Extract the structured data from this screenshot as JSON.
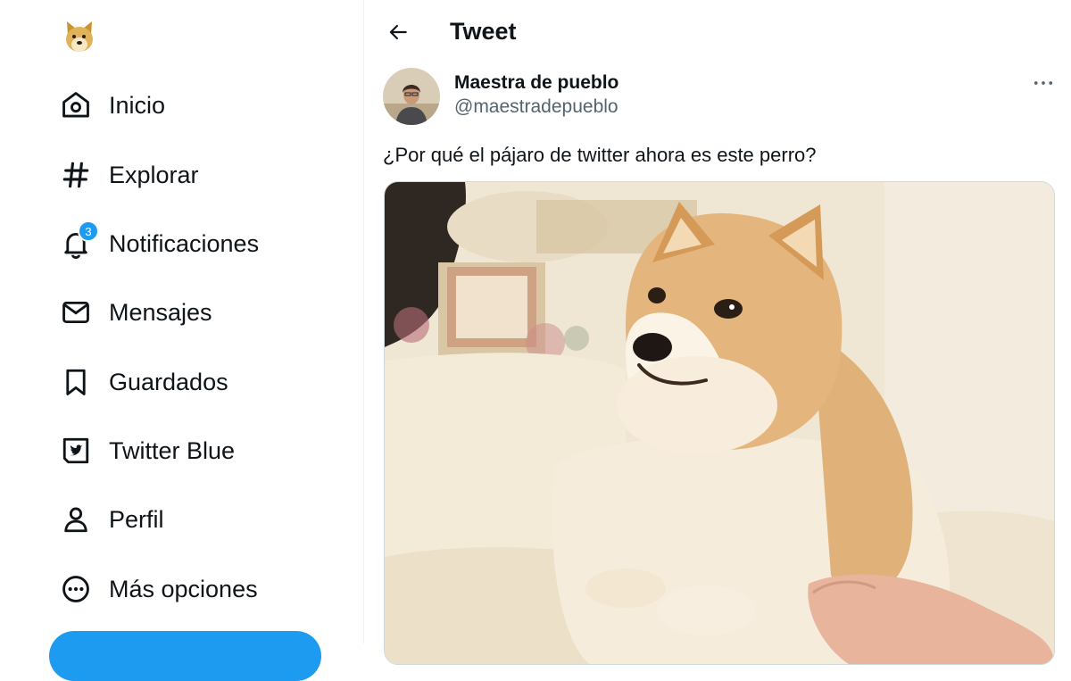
{
  "sidebar": {
    "logo": "doge-logo-icon",
    "items": [
      {
        "label": "Inicio",
        "icon": "home-icon"
      },
      {
        "label": "Explorar",
        "icon": "hashtag-icon"
      },
      {
        "label": "Notificaciones",
        "icon": "bell-icon",
        "badge": "3"
      },
      {
        "label": "Mensajes",
        "icon": "envelope-icon"
      },
      {
        "label": "Guardados",
        "icon": "bookmark-icon"
      },
      {
        "label": "Twitter Blue",
        "icon": "twitter-blue-icon"
      },
      {
        "label": "Perfil",
        "icon": "person-icon"
      },
      {
        "label": "Más opciones",
        "icon": "more-circle-icon"
      }
    ]
  },
  "header": {
    "title": "Tweet",
    "back_icon": "arrow-left-icon"
  },
  "tweet": {
    "author_name": "Maestra de pueblo",
    "author_handle": "@maestradepueblo",
    "text": "¿Por qué el pájaro de twitter ahora es este perro?",
    "more_icon": "more-dots-icon",
    "media": "shiba-inu-photo"
  },
  "colors": {
    "accent": "#1d9bf0",
    "text": "#0f1419",
    "secondary_text": "#536471",
    "border": "#cfd9de"
  }
}
